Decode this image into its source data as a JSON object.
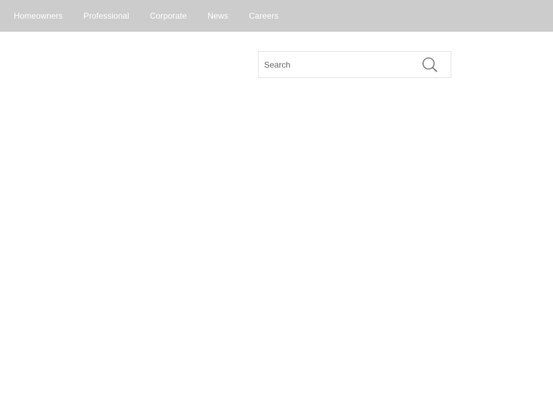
{
  "nav": {
    "items": [
      {
        "label": "Homeowners"
      },
      {
        "label": "Professional"
      },
      {
        "label": "Corporate"
      },
      {
        "label": "News"
      },
      {
        "label": "Careers"
      }
    ]
  },
  "search": {
    "placeholder": "Search",
    "value": "",
    "icon": "search-icon"
  },
  "colors": {
    "topbar_bg": "#cccccc",
    "nav_text": "#ffffff",
    "search_border": "#e3e3e3",
    "icon_stroke": "#777777"
  }
}
